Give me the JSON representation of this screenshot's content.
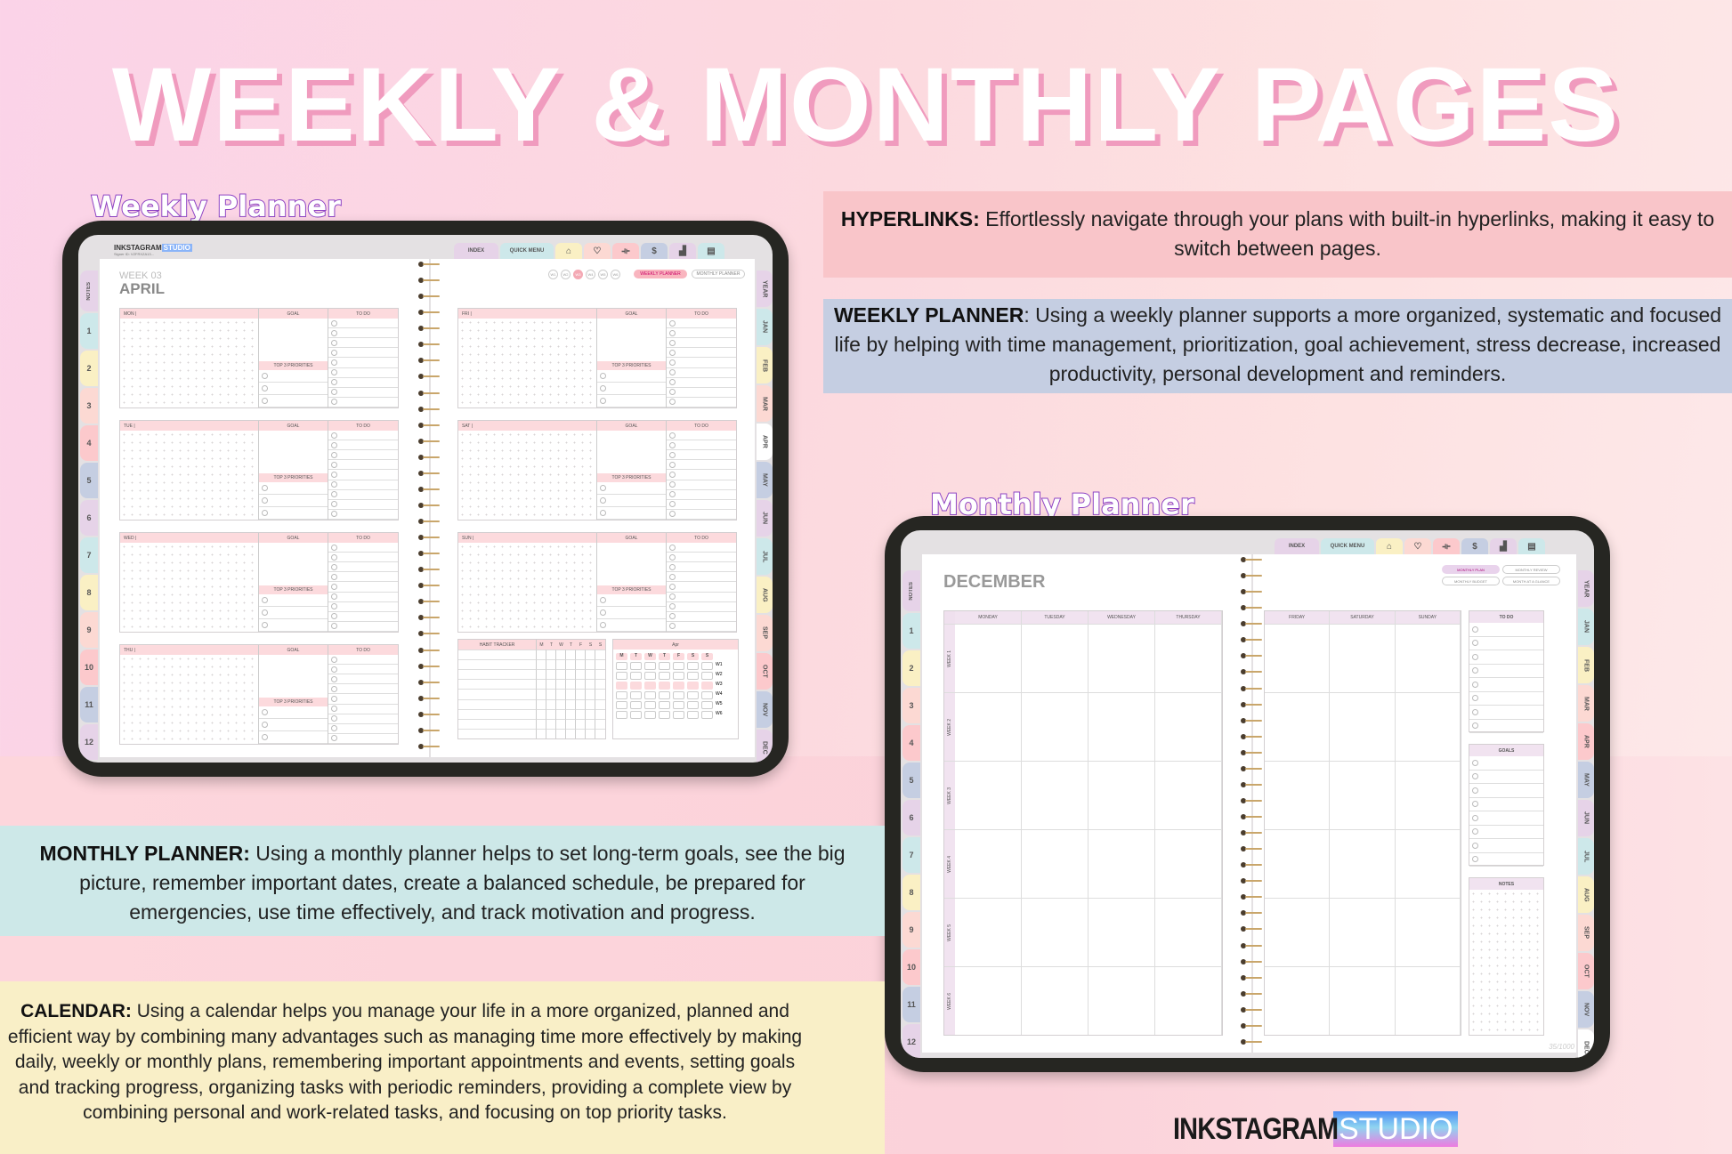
{
  "header": {
    "title": "WEEKLY & MONTHLY PAGES"
  },
  "labels": {
    "weekly": "Weekly Planner",
    "monthly": "Monthly Planner"
  },
  "info_boxes": {
    "hyperlinks": {
      "bold": "HYPERLINKS:",
      "text": " Effortlessly navigate through your plans with built-in hyperlinks, making it easy to switch between pages.",
      "color": "#f9c5c9"
    },
    "weekly": {
      "bold": "WEEKLY PLANNER",
      "text": ": Using a weekly planner supports a more organized, systematic and focused life by helping with time management, prioritization, goal achievement, stress decrease, increased productivity, personal development and reminders.",
      "color": "#c5cee2"
    },
    "monthly": {
      "bold": "MONTHLY PLANNER:",
      "text": " Using a monthly planner helps to set long-term goals, see the big picture, remember important dates, create a balanced schedule, be prepared for emergencies, use time effectively, and track motivation and progress.",
      "color": "#cde8e8"
    },
    "calendar": {
      "bold": "CALENDAR:",
      "text": " Using a calendar helps you manage your life in a more organized, planned and efficient way by combining many advantages such as managing time more effectively by making daily, weekly or monthly plans, remembering important appointments and events, setting goals and tracking progress, organizing tasks with periodic reminders, providing a complete view by combining personal and work-related tasks, and focusing on top priority tasks.",
      "color": "#f9efc7"
    }
  },
  "brand": {
    "name": "INKSTAGRAM",
    "studio": "STUDIO"
  },
  "planner_nav": {
    "top_tabs": [
      {
        "label": "INDEX",
        "icon": "",
        "color": "#e6d3e8"
      },
      {
        "label": "QUICK MENU",
        "icon": "",
        "color": "#cde8ea"
      },
      {
        "label": "",
        "icon": "home-icon",
        "glyph": "⌂",
        "color": "#faf0c4"
      },
      {
        "label": "",
        "icon": "heart-pulse-icon",
        "glyph": "♡",
        "color": "#fcd9d3"
      },
      {
        "label": "",
        "icon": "dumbbell-icon",
        "glyph": "⟛",
        "color": "#fcc9cc"
      },
      {
        "label": "",
        "icon": "money-icon",
        "glyph": "$",
        "color": "#c5cee2"
      },
      {
        "label": "",
        "icon": "chart-icon",
        "glyph": "▟",
        "color": "#e6d3e8"
      },
      {
        "label": "",
        "icon": "notebook-icon",
        "glyph": "▤",
        "color": "#cde8ea"
      }
    ],
    "left_tabs": [
      {
        "label": "NOTES",
        "color": "#e6d3e8"
      },
      {
        "label": "1",
        "color": "#cde8ea"
      },
      {
        "label": "2",
        "color": "#faf0c4"
      },
      {
        "label": "3",
        "color": "#fcd9d3"
      },
      {
        "label": "4",
        "color": "#fcc9cc"
      },
      {
        "label": "5",
        "color": "#c5cee2"
      },
      {
        "label": "6",
        "color": "#e6d3e8"
      },
      {
        "label": "7",
        "color": "#cde8ea"
      },
      {
        "label": "8",
        "color": "#faf0c4"
      },
      {
        "label": "9",
        "color": "#fcd9d3"
      },
      {
        "label": "10",
        "color": "#fcc9cc"
      },
      {
        "label": "11",
        "color": "#c5cee2"
      },
      {
        "label": "12",
        "color": "#e6d3e8"
      }
    ],
    "right_tabs": [
      {
        "label": "YEAR",
        "color": "#e6d3e8"
      },
      {
        "label": "JAN",
        "color": "#cde8ea"
      },
      {
        "label": "FEB",
        "color": "#faf0c4"
      },
      {
        "label": "MAR",
        "color": "#fcd9d3"
      },
      {
        "label": "APR",
        "color": "#fcc9cc"
      },
      {
        "label": "MAY",
        "color": "#c5cee2"
      },
      {
        "label": "JUN",
        "color": "#e6d3e8"
      },
      {
        "label": "JUL",
        "color": "#cde8ea"
      },
      {
        "label": "AUG",
        "color": "#faf0c4"
      },
      {
        "label": "SEP",
        "color": "#fcd9d3"
      },
      {
        "label": "OCT",
        "color": "#fcc9cc"
      },
      {
        "label": "NOV",
        "color": "#c5cee2"
      },
      {
        "label": "DEC",
        "color": "#e6d3e8"
      }
    ]
  },
  "weekly": {
    "logo_sub": "Signer ID: VZFRXZA13...",
    "week_label": "WEEK 03",
    "month": "APRIL",
    "active_month_tab": "APR",
    "week_buttons": [
      "W1",
      "W2",
      "W3",
      "W4",
      "W5",
      "W6"
    ],
    "active_week": "W3",
    "links": [
      {
        "label": "WEEKLY PLANNER",
        "active": true
      },
      {
        "label": "MONTHLY PLANNER",
        "active": false
      }
    ],
    "goal_label": "GOAL",
    "todo_label": "TO DO",
    "priorities_label": "TOP 3 PRIORITIES",
    "days_left": [
      "MON |",
      "TUE |",
      "WED |",
      "THU |"
    ],
    "days_right": [
      "FRI |",
      "SAT |",
      "SUN |"
    ],
    "habit_tracker": {
      "title": "HABIT TRACKER",
      "days": [
        "M",
        "T",
        "W",
        "T",
        "F",
        "S",
        "S"
      ]
    },
    "mini_calendar": {
      "month": "Apr",
      "days": [
        "M",
        "T",
        "W",
        "T",
        "F",
        "S",
        "S"
      ],
      "weeks": [
        "W1",
        "W2",
        "W3",
        "W4",
        "W5",
        "W6"
      ],
      "highlight_week": "W3"
    }
  },
  "monthly": {
    "month": "DECEMBER",
    "active_month_tab": "DEC",
    "links": [
      {
        "label": "MONTHLY PLAN",
        "active": true
      },
      {
        "label": "MONTHLY REVIEW",
        "active": false
      },
      {
        "label": "MONTHLY BUDGET",
        "active": false
      },
      {
        "label": "MONTH AT A GLANCE",
        "active": false
      }
    ],
    "days_left": [
      "MONDAY",
      "TUESDAY",
      "WEDNESDAY",
      "THURSDAY"
    ],
    "days_right": [
      "FRIDAY",
      "SATURDAY",
      "SUNDAY"
    ],
    "weeks": [
      "WEEK 1",
      "WEEK 2",
      "WEEK 3",
      "WEEK 4",
      "WEEK 5",
      "WEEK 6"
    ],
    "todo_label": "TO DO",
    "goals_label": "GOALS",
    "notes_label": "NOTES",
    "watermark": "35/1000"
  }
}
